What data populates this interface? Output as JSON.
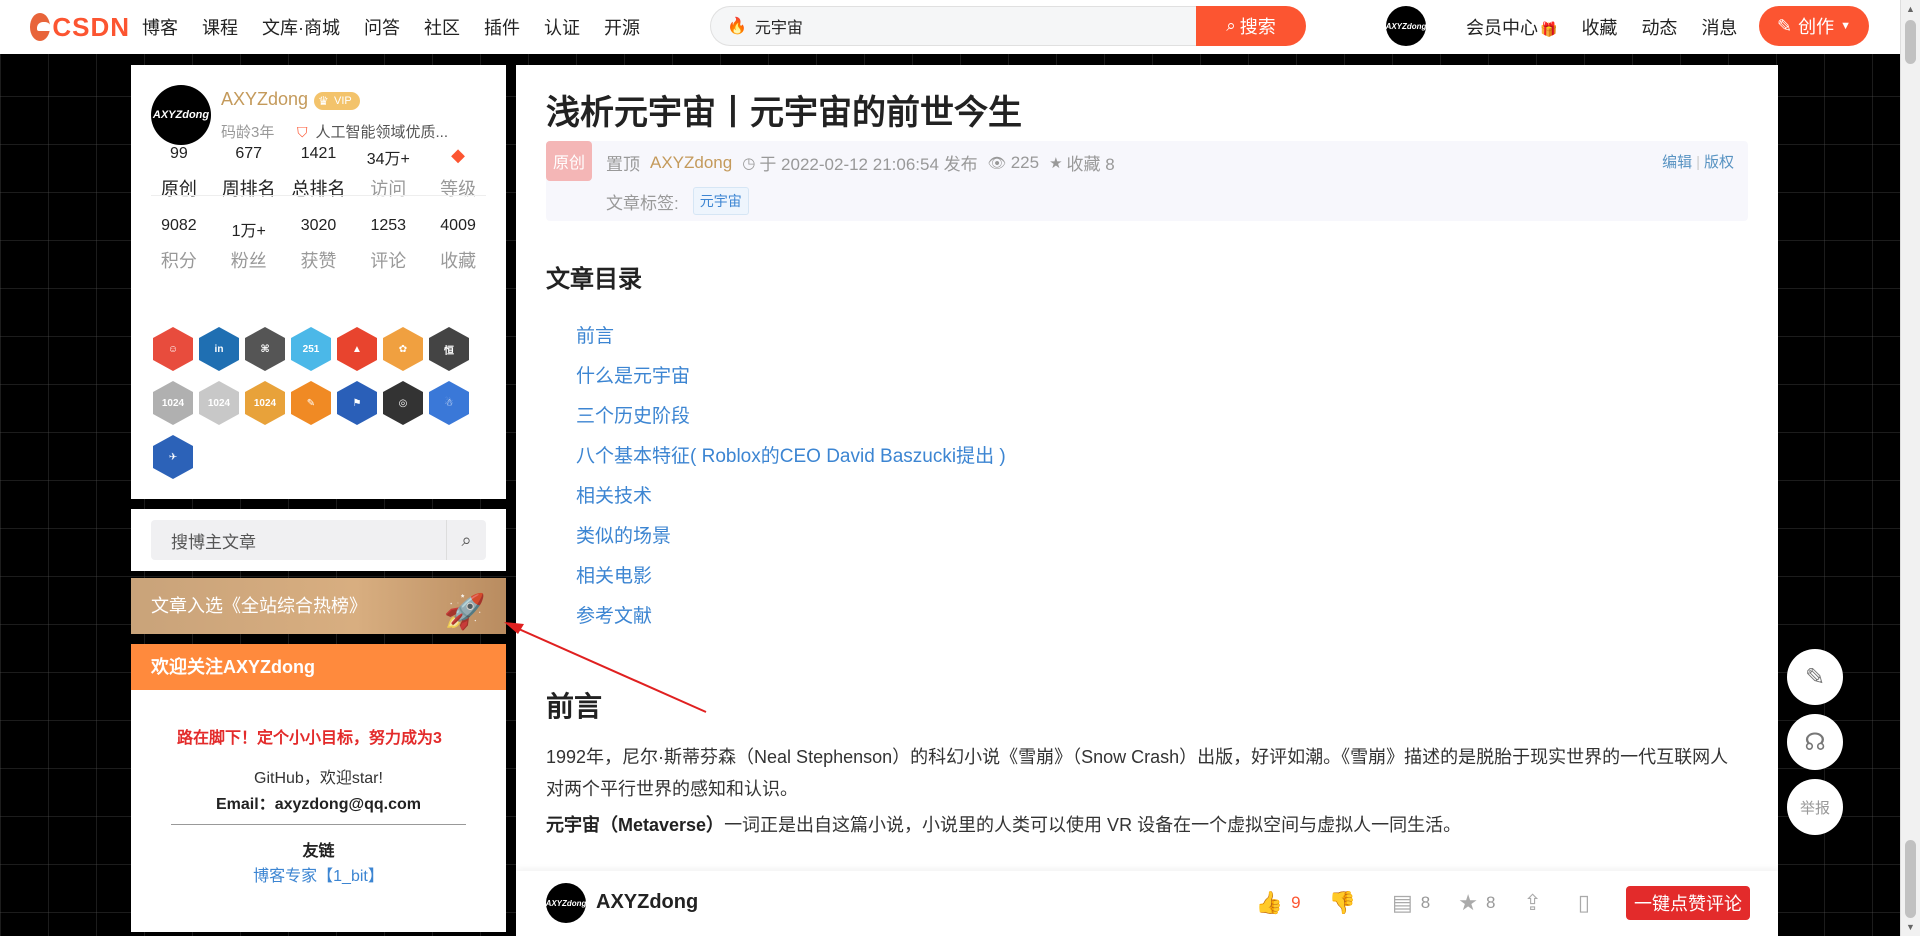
{
  "topbar": {
    "logo": "CSDN",
    "nav": [
      "博客",
      "课程",
      "文库·商城",
      "问答",
      "社区",
      "插件",
      "认证",
      "开源"
    ],
    "search_value": "元宇宙",
    "search_button": "搜索",
    "avatar_text": "AXYZdong",
    "links": [
      "会员中心",
      "收藏",
      "动态",
      "消息"
    ],
    "create_label": "创作"
  },
  "profile": {
    "avatar_text": "AXYZdong",
    "name": "AXYZdong",
    "vip": "VIP",
    "age": "码龄3年",
    "expert": "人工智能领域优质...",
    "stats_row1": [
      {
        "num": "99",
        "label": "原创"
      },
      {
        "num": "677",
        "label": "周排名"
      },
      {
        "num": "1421",
        "label": "总排名"
      },
      {
        "num": "34万+",
        "label": "访问"
      },
      {
        "num": "",
        "label": "等级"
      }
    ],
    "stats_row2": [
      {
        "num": "9082",
        "label": "积分"
      },
      {
        "num": "1万+",
        "label": "粉丝"
      },
      {
        "num": "3020",
        "label": "获赞"
      },
      {
        "num": "1253",
        "label": "评论"
      },
      {
        "num": "4009",
        "label": "收藏"
      }
    ],
    "badges": [
      {
        "text": "☺",
        "color": "#e84c3d"
      },
      {
        "text": "in",
        "color": "#1f6fb2"
      },
      {
        "text": "⌘",
        "color": "#555"
      },
      {
        "text": "251",
        "color": "#4bb8e8"
      },
      {
        "text": "▲",
        "color": "#e8442e"
      },
      {
        "text": "✿",
        "color": "#f0a040"
      },
      {
        "text": "恒",
        "color": "#444"
      },
      {
        "text": "1024",
        "color": "#b0b0b0"
      },
      {
        "text": "1024",
        "color": "#c8c8c8"
      },
      {
        "text": "1024",
        "color": "#e8a23a"
      },
      {
        "text": "✎",
        "color": "#f08a24"
      },
      {
        "text": "⚑",
        "color": "#2a5fb8"
      },
      {
        "text": "◎",
        "color": "#333"
      },
      {
        "text": "☃",
        "color": "#3a78d8"
      },
      {
        "text": "✈",
        "color": "#2c62b8"
      }
    ]
  },
  "blog_search": {
    "placeholder": "搜博主文章"
  },
  "hot_banner": "文章入选《全站综合热榜》",
  "follow": {
    "title": "欢迎关注AXYZdong",
    "red_text": "路在脚下！定个小小目标，努力成为3",
    "github": "GitHub，欢迎star!",
    "email": "Email：axyzdong@qq.com",
    "links_title": "友链",
    "link1": "博客专家【1_bit】"
  },
  "article": {
    "title": "浅析元宇宙丨元宇宙的前世今生",
    "original_tag": "原创",
    "pin": "置顶",
    "author": "AXYZdong",
    "date": "于 2022-02-12 21:06:54 发布",
    "views": "225",
    "favorites": "收藏 8",
    "edit": "编辑",
    "copyright": "版权",
    "tag_label": "文章标签:",
    "tag": "元宇宙",
    "toc_title": "文章目录",
    "toc": [
      "前言",
      "什么是元宇宙",
      "三个历史阶段",
      "八个基本特征( Roblox的CEO David Baszucki提出 )",
      "相关技术",
      "类似的场景",
      "相关电影",
      "参考文献"
    ],
    "section_title": "前言",
    "para1": "1992年，尼尔·斯蒂芬森（Neal Stephenson）的科幻小说《雪崩》（Snow Crash）出版，好评如潮。《雪崩》描述的是脱胎于现实世界的一代互联网人对两个平行世界的感知和认识。",
    "para2_bold": "元宇宙（Metaverse）",
    "para2_rest": "一词正是出自这篇小说，小说里的人类可以使用 VR 设备在一个虚拟空间与虚拟人一同生活。"
  },
  "bottom_bar": {
    "avatar_text": "AXYZdong",
    "name": "AXYZdong",
    "likes": "9",
    "comments": "8",
    "favorites": "8",
    "comment_button": "一键点赞评论"
  },
  "float_tools": {
    "report": "举报"
  },
  "colors": {
    "accent": "#fc5531",
    "link": "#3c85d2",
    "annotation_arrow": "#e02020"
  }
}
